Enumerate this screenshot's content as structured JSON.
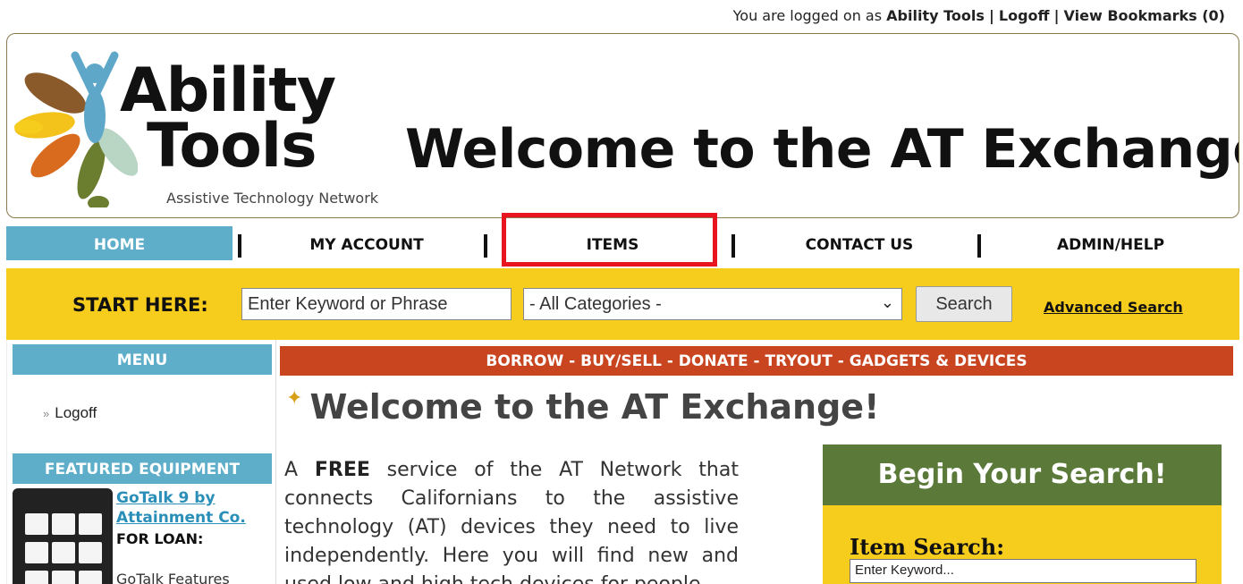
{
  "topbar": {
    "prefix": "You are logged on as",
    "user": "Ability Tools",
    "logoff": "Logoff",
    "bookmarks": "View Bookmarks (0)",
    "sep": "|"
  },
  "header": {
    "logo_word1": "Ability",
    "logo_word2": "Tools",
    "logo_tagline": "Assistive Technology Network",
    "title": "Welcome to the AT Exchange"
  },
  "nav": {
    "items": [
      {
        "label": "HOME"
      },
      {
        "label": "MY ACCOUNT"
      },
      {
        "label": "ITEMS"
      },
      {
        "label": "CONTACT US"
      },
      {
        "label": "ADMIN/HELP"
      }
    ]
  },
  "search": {
    "start_label": "START HERE:",
    "keyword_value": "Enter Keyword or Phrase",
    "category_value": "- All Categories -",
    "button": "Search",
    "advanced": "Advanced Search"
  },
  "left": {
    "menu_head": "MENU",
    "menu_items": [
      {
        "label": "Logoff"
      }
    ],
    "featured_head": "FEATURED EQUIPMENT",
    "featured_title": "GoTalk 9 by Attainment Co.",
    "featured_status": "FOR LOAN:",
    "featured_desc": "GoTalk Features"
  },
  "main": {
    "banner": "BORROW - BUY/SELL - DONATE - TRYOUT - GADGETS & DEVICES",
    "title": "Welcome to the AT Exchange!",
    "intro_a": "A",
    "intro_free": "FREE",
    "intro_b": "service of the AT Network that connects Californians to the assistive technology (AT) devices they need to live independently. Here you will find new and used low and high tech devices for people"
  },
  "sidebox": {
    "head": "Begin Your Search!",
    "item_search_label": "Item Search:",
    "item_keyword_value": "Enter Keyword..."
  },
  "colors": {
    "nav_blue": "#5eaec9",
    "band_yellow": "#f6cc1d",
    "banner_orange": "#c84520",
    "box_green": "#5b7a3a",
    "highlight_red": "#e8141f"
  }
}
